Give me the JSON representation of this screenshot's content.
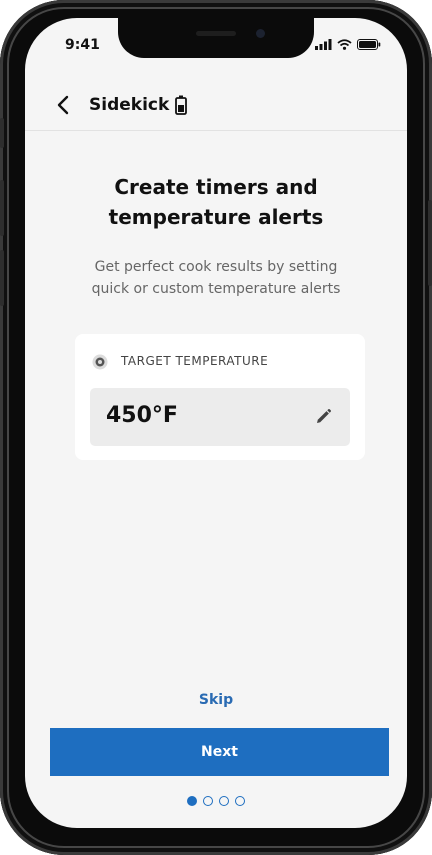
{
  "status_bar": {
    "time": "9:41"
  },
  "nav": {
    "title": "Sidekick"
  },
  "content": {
    "title_line1": "Create timers and",
    "title_line2": "temperature alerts",
    "subtitle_line1": "Get perfect cook results by setting",
    "subtitle_line2": "quick or custom temperature alerts"
  },
  "card": {
    "label": "TARGET TEMPERATURE",
    "value": "450°F"
  },
  "actions": {
    "skip_label": "Skip",
    "next_label": "Next"
  },
  "pagination": {
    "total": 4,
    "current": 1
  },
  "colors": {
    "accent": "#1e6ec0",
    "link": "#2a6bb3",
    "background": "#f5f5f5"
  },
  "icons": [
    "back-chevron-icon",
    "battery-icon",
    "thermometer-icon",
    "pencil-icon",
    "signal-icon",
    "wifi-icon",
    "status-battery-icon"
  ]
}
